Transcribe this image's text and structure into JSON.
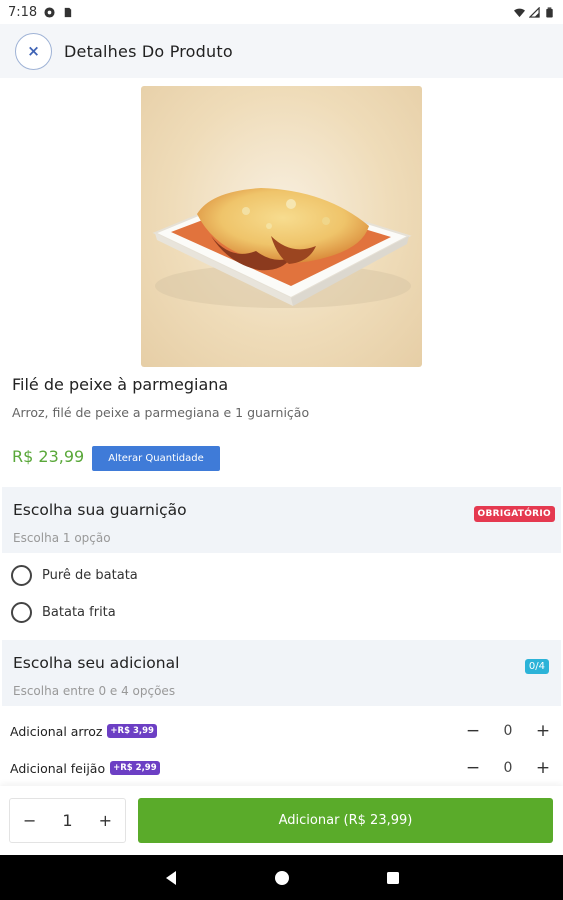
{
  "status_bar": {
    "time": "7:18"
  },
  "app_bar": {
    "close_label": "×",
    "title": "Detalhes Do Produto"
  },
  "product": {
    "name": "Filé de peixe à parmegiana",
    "description": "Arroz, filé de peixe a parmegiana e 1 guarnição",
    "price": "R$ 23,99",
    "change_quantity_label": "Alterar Quantidade"
  },
  "side_section": {
    "title": "Escolha sua guarnição",
    "subtitle": "Escolha 1 opção",
    "badge": "OBRIGATÓRIO",
    "options": [
      {
        "label": "Purê de batata"
      },
      {
        "label": "Batata frita"
      }
    ]
  },
  "addon_section": {
    "title": "Escolha seu adicional",
    "subtitle": "Escolha entre 0 e 4 opções",
    "badge": "0/4",
    "items": [
      {
        "name": "Adicional arroz",
        "price": "+R$ 3,99",
        "minus": "−",
        "qty": "0",
        "plus": "+"
      },
      {
        "name": "Adicional feijão",
        "price": "+R$ 2,99",
        "minus": "−",
        "qty": "0",
        "plus": "+"
      }
    ]
  },
  "footer": {
    "minus": "−",
    "quantity": "1",
    "plus": "+",
    "add_button_label": "Adicionar (R$ 23,99)"
  },
  "icons": {
    "status": [
      "cast-icon",
      "sd-card-icon",
      "wifi-icon",
      "signal-icon",
      "battery-icon"
    ],
    "nav": [
      "back-icon",
      "home-icon",
      "recents-icon"
    ]
  },
  "colors": {
    "accent_blue": "#3f7bd8",
    "price_green": "#5aa83a",
    "add_button_green": "#5aab2a",
    "required_red": "#e53950",
    "counter_cyan": "#2cb3d8",
    "addon_price_purple": "#6c3fc4"
  }
}
